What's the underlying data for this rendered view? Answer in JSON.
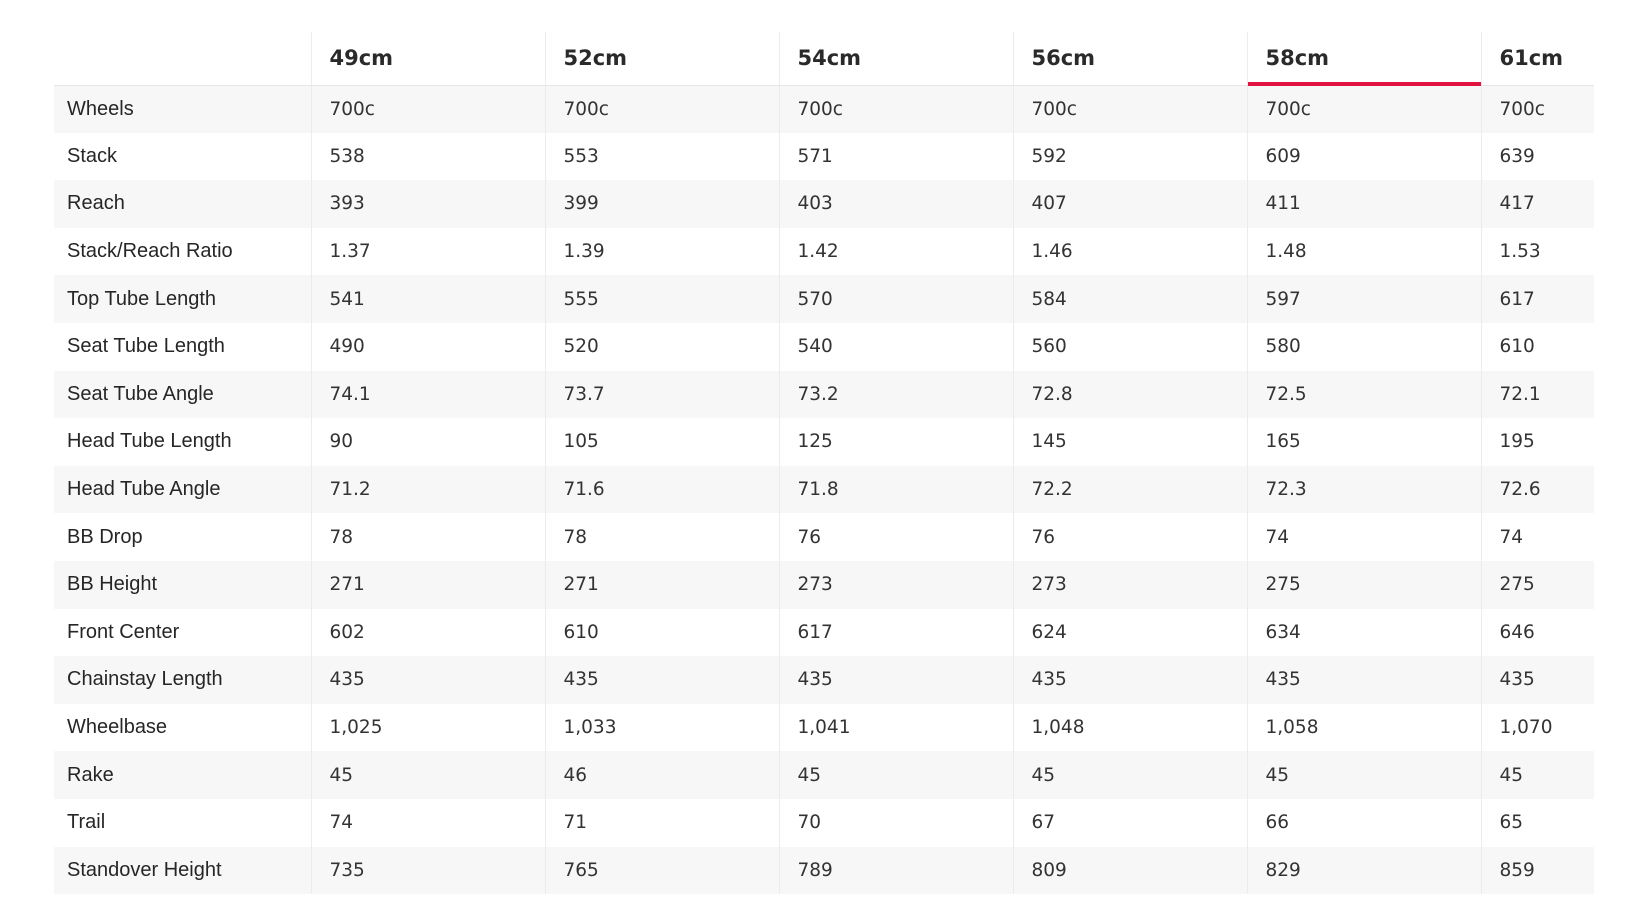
{
  "colors": {
    "active_underline": "#e0123f",
    "stripe": "#f7f7f7",
    "text": "#2b2b2b"
  },
  "geometry_table": {
    "active_size_index": 4,
    "corner_label": "",
    "sizes": [
      "49cm",
      "52cm",
      "54cm",
      "56cm",
      "58cm",
      "61cm"
    ],
    "rows": [
      {
        "label": "Wheels",
        "values": [
          "700c",
          "700c",
          "700c",
          "700c",
          "700c",
          "700c"
        ]
      },
      {
        "label": "Stack",
        "values": [
          "538",
          "553",
          "571",
          "592",
          "609",
          "639"
        ]
      },
      {
        "label": "Reach",
        "values": [
          "393",
          "399",
          "403",
          "407",
          "411",
          "417"
        ]
      },
      {
        "label": "Stack/Reach Ratio",
        "values": [
          "1.37",
          "1.39",
          "1.42",
          "1.46",
          "1.48",
          "1.53"
        ]
      },
      {
        "label": "Top Tube Length",
        "values": [
          "541",
          "555",
          "570",
          "584",
          "597",
          "617"
        ]
      },
      {
        "label": "Seat Tube Length",
        "values": [
          "490",
          "520",
          "540",
          "560",
          "580",
          "610"
        ]
      },
      {
        "label": "Seat Tube Angle",
        "values": [
          "74.1",
          "73.7",
          "73.2",
          "72.8",
          "72.5",
          "72.1"
        ]
      },
      {
        "label": "Head Tube Length",
        "values": [
          "90",
          "105",
          "125",
          "145",
          "165",
          "195"
        ]
      },
      {
        "label": "Head Tube Angle",
        "values": [
          "71.2",
          "71.6",
          "71.8",
          "72.2",
          "72.3",
          "72.6"
        ]
      },
      {
        "label": "BB Drop",
        "values": [
          "78",
          "78",
          "76",
          "76",
          "74",
          "74"
        ]
      },
      {
        "label": "BB Height",
        "values": [
          "271",
          "271",
          "273",
          "273",
          "275",
          "275"
        ]
      },
      {
        "label": "Front Center",
        "values": [
          "602",
          "610",
          "617",
          "624",
          "634",
          "646"
        ]
      },
      {
        "label": "Chainstay Length",
        "values": [
          "435",
          "435",
          "435",
          "435",
          "435",
          "435"
        ]
      },
      {
        "label": "Wheelbase",
        "values": [
          "1,025",
          "1,033",
          "1,041",
          "1,048",
          "1,058",
          "1,070"
        ]
      },
      {
        "label": "Rake",
        "values": [
          "45",
          "46",
          "45",
          "45",
          "45",
          "45"
        ]
      },
      {
        "label": "Trail",
        "values": [
          "74",
          "71",
          "70",
          "67",
          "66",
          "65"
        ]
      },
      {
        "label": "Standover Height",
        "values": [
          "735",
          "765",
          "789",
          "809",
          "829",
          "859"
        ]
      }
    ]
  }
}
